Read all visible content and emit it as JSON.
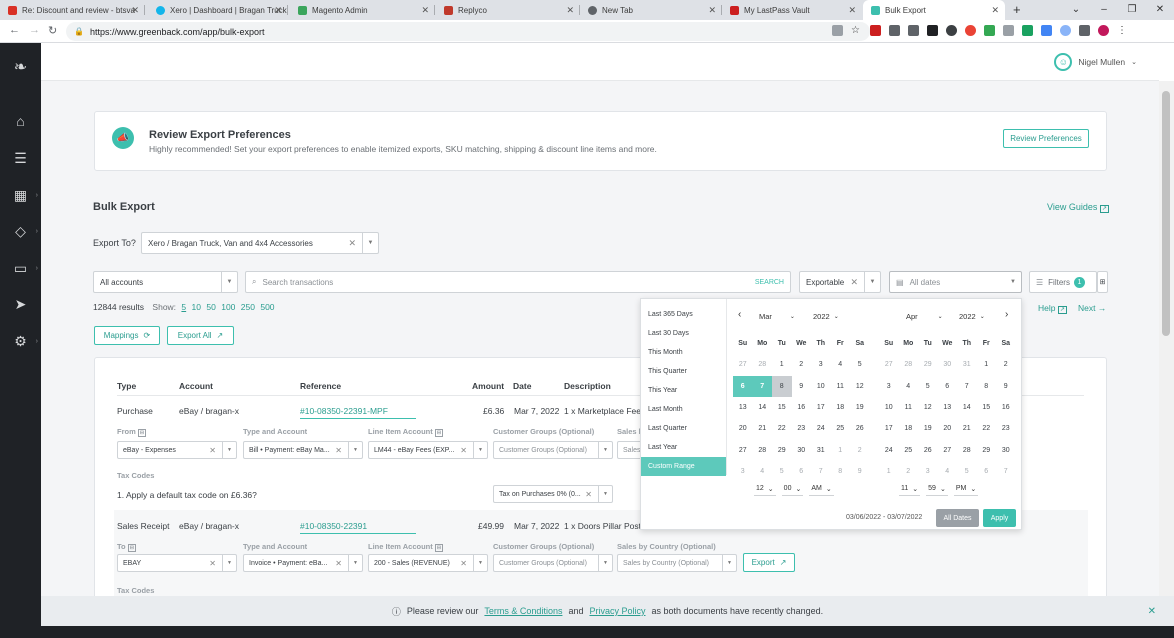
{
  "browser": {
    "tabs": [
      {
        "title": "Re: Discount and review - btsva",
        "color": "#d93025"
      },
      {
        "title": "Xero | Dashboard | Bragan Truck",
        "color": "#13b5ea"
      },
      {
        "title": "Magento Admin",
        "color": "#3ba55c"
      },
      {
        "title": "Replyco",
        "color": "#c0392b"
      },
      {
        "title": "New Tab",
        "color": "#5f6368"
      },
      {
        "title": "My LastPass Vault",
        "color": "#cc1f1f"
      },
      {
        "title": "Bulk Export",
        "color": "#3dbfae"
      }
    ],
    "new_tab": "+",
    "url": "https://www.greenback.com/app/bulk-export"
  },
  "user": {
    "name": "Nigel Mullen"
  },
  "prefs": {
    "title": "Review Export Preferences",
    "subtitle": "Highly recommended! Set your export preferences to enable itemized exports, SKU matching, shipping & discount line items and more.",
    "button": "Review Preferences"
  },
  "bulk": {
    "title": "Bulk Export",
    "view_guides": "View Guides",
    "export_to_label": "Export To?",
    "export_to_value": "Xero / Bragan Truck, Van and 4x4 Accessories"
  },
  "filters": {
    "accounts": "All accounts",
    "search_placeholder": "Search transactions",
    "search_btn": "SEARCH",
    "status": "Exportable",
    "dates": "All dates",
    "filters_label": "Filters",
    "filters_count": "1"
  },
  "results": {
    "count": "12844 results",
    "show_label": "Show:",
    "show_options": [
      "5",
      "10",
      "50",
      "100",
      "250",
      "500"
    ],
    "help": "Help",
    "next": "Next"
  },
  "actions": {
    "mappings": "Mappings",
    "export_all": "Export All"
  },
  "table": {
    "headers": {
      "type": "Type",
      "account": "Account",
      "reference": "Reference",
      "amount": "Amount",
      "date": "Date",
      "description": "Description"
    },
    "rows": [
      {
        "type": "Purchase",
        "account": "eBay / bragan-x",
        "reference": "#10-08350-22391-MPF",
        "amount": "£6.36",
        "date": "Mar 7, 2022",
        "description": "1 x Marketplace Fee f",
        "from_label": "From",
        "type_account_label": "Type and Account",
        "line_item_label": "Line Item Account",
        "cust_groups_label": "Customer Groups (Optional)",
        "sales_label": "Sales b",
        "from": "eBay - Expenses",
        "type_account": "Bill • Payment: eBay Ma...",
        "line_item": "LM44 - eBay Fees (EXP...",
        "cust_groups": "Customer Groups (Optional)",
        "sales": "Sales",
        "tax_label": "Tax Codes",
        "tax_q": "1. Apply a default tax code on £6.36?",
        "tax_value": "Tax on Purchases 0% (0..."
      },
      {
        "type": "Sales Receipt",
        "account": "eBay / bragan-x",
        "reference": "#10-08350-22391",
        "amount": "£49.99",
        "date": "Mar 7, 2022",
        "description": "1 x Doors Pillar Post C",
        "to_label": "To",
        "type_account_label": "Type and Account",
        "line_item_label": "Line Item Account",
        "cust_groups_label": "Customer Groups (Optional)",
        "sales_label": "Sales by Country (Optional)",
        "to": "EBAY",
        "type_account": "Invoice • Payment: eBa...",
        "line_item": "200 - Sales (REVENUE)",
        "cust_groups": "Customer Groups (Optional)",
        "sales": "Sales by Country (Optional)",
        "export": "Export",
        "tax_label": "Tax Codes"
      }
    ]
  },
  "datepicker": {
    "presets": [
      "Last 365 Days",
      "Last 30 Days",
      "This Month",
      "This Quarter",
      "This Year",
      "Last Month",
      "Last Quarter",
      "Last Year",
      "Custom Range"
    ],
    "active_preset": "Custom Range",
    "weekdays": [
      "Su",
      "Mo",
      "Tu",
      "We",
      "Th",
      "Fr",
      "Sa"
    ],
    "left": {
      "month": "Mar",
      "year": "2022",
      "days": [
        "27",
        "28",
        "1",
        "2",
        "3",
        "4",
        "5",
        "6",
        "7",
        "8",
        "9",
        "10",
        "11",
        "12",
        "13",
        "14",
        "15",
        "16",
        "17",
        "18",
        "19",
        "20",
        "21",
        "22",
        "23",
        "24",
        "25",
        "26",
        "27",
        "28",
        "29",
        "30",
        "31",
        "1",
        "2",
        "3",
        "4",
        "5",
        "6",
        "7",
        "8",
        "9"
      ],
      "other_month": [
        0,
        1,
        33,
        34,
        35,
        36,
        37,
        38,
        39,
        40,
        41
      ],
      "selected": [
        7,
        8
      ],
      "hover": [
        9
      ]
    },
    "right": {
      "month": "Apr",
      "year": "2022",
      "days": [
        "27",
        "28",
        "29",
        "30",
        "31",
        "1",
        "2",
        "3",
        "4",
        "5",
        "6",
        "7",
        "8",
        "9",
        "10",
        "11",
        "12",
        "13",
        "14",
        "15",
        "16",
        "17",
        "18",
        "19",
        "20",
        "21",
        "22",
        "23",
        "24",
        "25",
        "26",
        "27",
        "28",
        "29",
        "30",
        "1",
        "2",
        "3",
        "4",
        "5",
        "6",
        "7"
      ],
      "other_month": [
        0,
        1,
        2,
        3,
        4,
        35,
        36,
        37,
        38,
        39,
        40,
        41
      ]
    },
    "left_time": {
      "hour": "12",
      "minute": "00",
      "ampm": "AM"
    },
    "right_time": {
      "hour": "11",
      "minute": "59",
      "ampm": "PM"
    },
    "range": "03/06/2022 - 03/07/2022",
    "all_dates": "All Dates",
    "apply": "Apply"
  },
  "notice": {
    "pre": "Please review our",
    "terms": "Terms & Conditions",
    "and": "and",
    "privacy": "Privacy Policy",
    "post": "as both documents have recently changed."
  },
  "colors": {
    "accent": "#3dbfae",
    "sidebar": "#1f2226"
  }
}
